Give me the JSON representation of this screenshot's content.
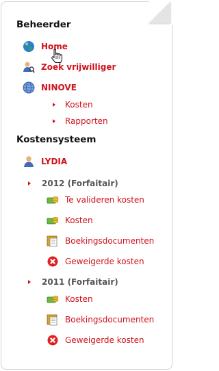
{
  "sections": {
    "beheerder": "Beheerder",
    "kostensysteem": "Kostensysteem"
  },
  "nav": {
    "home": "Home",
    "zoek": "Zoek vrijwilliger",
    "ninove": "NINOVE",
    "ninove_kosten": "Kosten",
    "ninove_rapporten": "Rapporten",
    "lydia": "LYDIA"
  },
  "years": {
    "y2012": "2012 (Forfaitair)",
    "y2011": "2011 (Forfaitair)"
  },
  "y2012_items": {
    "te_valideren": "Te valideren kosten",
    "kosten": "Kosten",
    "boekingsdocumenten": "Boekingsdocumenten",
    "geweigerde": "Geweigerde kosten"
  },
  "y2011_items": {
    "kosten": "Kosten",
    "boekingsdocumenten": "Boekingsdocumenten",
    "geweigerde": "Geweigerde kosten"
  },
  "icons": [
    "globe-icon",
    "search-user-icon",
    "network-globe-icon",
    "user-icon",
    "money-icon",
    "document-icon",
    "reject-icon",
    "cursor-hand-icon"
  ],
  "colors": {
    "link": "#d0121b",
    "year": "#555555",
    "title": "#111111"
  }
}
